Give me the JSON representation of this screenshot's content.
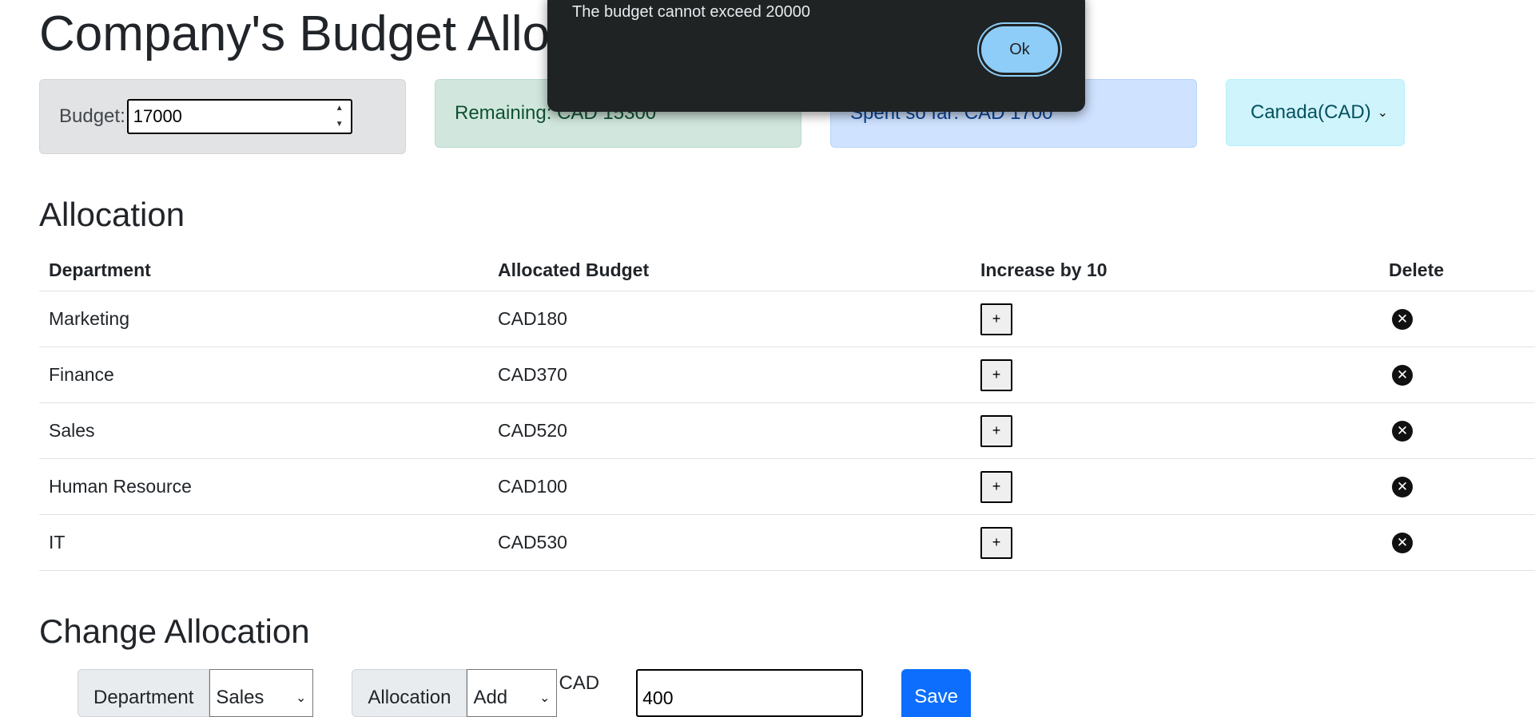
{
  "header": {
    "title": "Company's Budget Allocation"
  },
  "cards": {
    "budget_label": "Budget:",
    "budget_value": "17000",
    "remaining": "Remaining: CAD 15300",
    "spent": "Spent so far: CAD 1700",
    "currency_selected": "Canada(CAD)"
  },
  "allocation": {
    "title": "Allocation",
    "headers": [
      "Department",
      "Allocated Budget",
      "Increase by 10",
      "Delete"
    ],
    "rows": [
      {
        "department": "Marketing",
        "budget": "CAD180",
        "increase": "+"
      },
      {
        "department": "Finance",
        "budget": "CAD370",
        "increase": "+"
      },
      {
        "department": "Sales",
        "budget": "CAD520",
        "increase": "+"
      },
      {
        "department": "Human Resource",
        "budget": "CAD100",
        "increase": "+"
      },
      {
        "department": "IT",
        "budget": "CAD530",
        "increase": "+"
      }
    ]
  },
  "change": {
    "title": "Change Allocation",
    "department_label": "Department",
    "department_value": "Sales",
    "allocation_label": "Allocation",
    "allocation_value": "Add",
    "currency_label": "CAD",
    "amount_value": "400",
    "save_label": "Save"
  },
  "dialog": {
    "message": "The budget cannot exceed 20000",
    "ok_label": "Ok"
  },
  "icons": {
    "spin_up": "▲",
    "spin_down": "▼",
    "chevron": "⌄",
    "delete": "✕"
  },
  "colors": {
    "remaining_bg": "#d1e7dd",
    "spent_bg": "#cfe2ff",
    "currency_bg": "#cff4fc",
    "save_bg": "#0d6efd",
    "dialog_bg": "#1f2324",
    "ok_bg": "#8ecdf7"
  }
}
